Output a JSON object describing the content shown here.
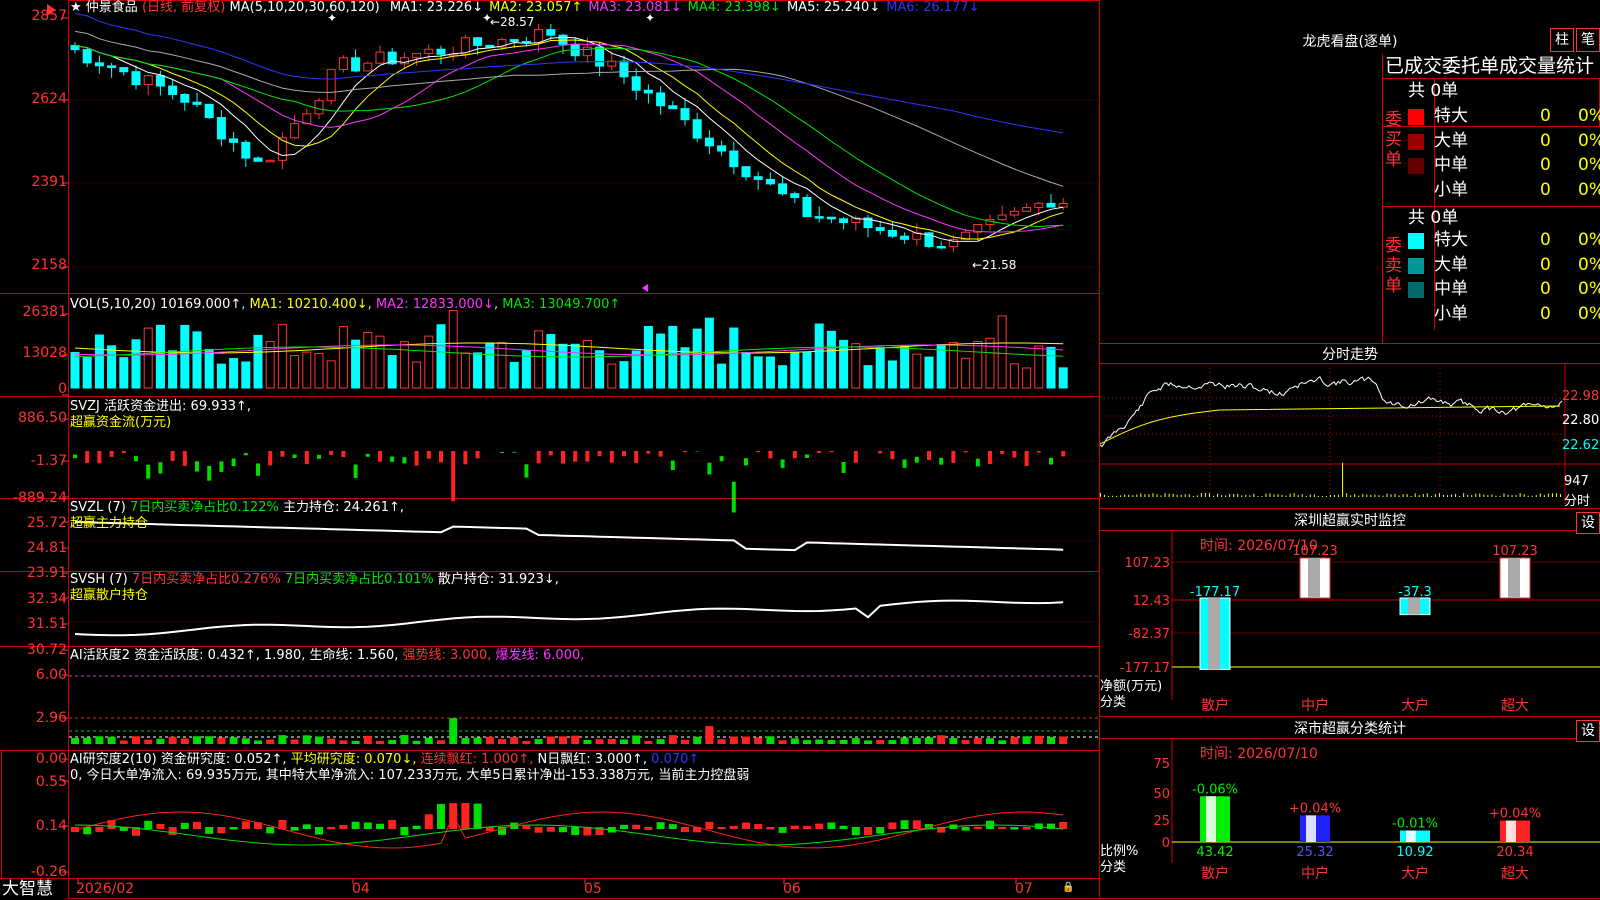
{
  "stock": {
    "name": "仲景食品",
    "mode": "(日线, 前复权)",
    "ma_params": "MA(5,10,20,30,60,120)",
    "ma": [
      {
        "label": "MA1:",
        "value": "23.226↓",
        "color": "#ffffff"
      },
      {
        "label": "MA2:",
        "value": "23.057↑",
        "color": "#ffff00"
      },
      {
        "label": "MA3:",
        "value": "23.081↓",
        "color": "#ff33ff"
      },
      {
        "label": "MA4:",
        "value": "23.398↓",
        "color": "#00e600"
      },
      {
        "label": "MA5:",
        "value": "25.240↓",
        "color": "#ffffff"
      },
      {
        "label": "MA6:",
        "value": "26.177↓",
        "color": "#3333ff"
      }
    ],
    "high_label": "28.57",
    "low_label": "21.58"
  },
  "price_axis": [
    "2857",
    "2624",
    "2391",
    "2158"
  ],
  "vol_panel": {
    "title": "VOL(5,10,20)",
    "value": "10169.000↑",
    "ma1": "MA1: 10210.400↓",
    "ma2": "MA2: 12833.000↓",
    "ma3": "MA3: 13049.700↑",
    "axis": [
      "26381",
      "13028",
      "0"
    ]
  },
  "svzj_panel": {
    "title": "SVZJ",
    "line1": "活跃资金进出: 69.933↑,",
    "line2": "超赢资金流(万元)",
    "axis": [
      "886.50",
      "-1.37",
      "-889.24"
    ]
  },
  "svzl_panel": {
    "title": "SVZL (7)",
    "seg1": "7日内买卖净占比0.122%",
    "seg2": "主力持仓: 24.261↑,",
    "line2": "超赢主力持仓",
    "axis": [
      "25.72",
      "24.81",
      "23.91"
    ]
  },
  "svsh_panel": {
    "title": "SVSH (7)",
    "seg1": "7日内买卖净占比0.276%",
    "seg2": "7日内买卖净占比0.101%",
    "seg3": "散户持仓: 31.923↓,",
    "line2": "超赢散户持仓",
    "axis": [
      "32.34",
      "31.51",
      "30.72"
    ]
  },
  "ai_active_panel": {
    "seg1": "AI活跃度2 资金活跃度: 0.432↑, 1.980, 生命线: 1.560,",
    "seg2": "强势线: 3.000,",
    "seg3": "爆发线: 6.000,",
    "axis": [
      "6.00",
      "2.96",
      "0.00"
    ]
  },
  "ai_research_panel": {
    "seg1": "AI研究度2(10) 资金研究度: 0.052↑,",
    "seg2": "平均研究度: 0.070↓,",
    "seg3": "连续飘红: 1.000↑,",
    "seg4": "N日飘红: 3.000↑,",
    "seg5": "0.070↑",
    "line2": "0, 今日大单净流入: 69.935万元, 其中特大单净流入: 107.233万元, 大单5日累计净出-153.338万元, 当前主力控盘弱",
    "axis": [
      "0.55",
      "0.14",
      "-0.26"
    ]
  },
  "x_axis": [
    "2026/02",
    "04",
    "05",
    "06",
    "07"
  ],
  "footer_brand": "大智慧",
  "lhb": {
    "title": "龙虎看盘(逐单)",
    "btn1": "柱",
    "btn2": "笔",
    "stats_title": "已成交委托单成交量统计",
    "buy_label": "委买单",
    "sell_label": "委卖单",
    "buy_total": "共 0单",
    "sell_total": "共 0单",
    "buy_rows": [
      {
        "name": "特大",
        "value": "0",
        "pct": "0%",
        "color": "#ff0000"
      },
      {
        "name": "大单",
        "value": "0",
        "pct": "0%",
        "color": "#990000"
      },
      {
        "name": "中单",
        "value": "0",
        "pct": "0%",
        "color": "#660000"
      },
      {
        "name": "小单",
        "value": "0",
        "pct": "0%",
        "color": "#000000"
      }
    ],
    "sell_rows": [
      {
        "name": "特大",
        "value": "0",
        "pct": "0%",
        "color": "#00ffff"
      },
      {
        "name": "大单",
        "value": "0",
        "pct": "0%",
        "color": "#009999"
      },
      {
        "name": "中单",
        "value": "0",
        "pct": "0%",
        "color": "#006b6b"
      },
      {
        "name": "小单",
        "value": "0",
        "pct": "0%",
        "color": "#000000"
      }
    ]
  },
  "intraday": {
    "title": "分时走势",
    "axis": [
      "22.98",
      "22.80",
      "22.62"
    ],
    "vol_label": "947",
    "vol_unit": "分时"
  },
  "sz_monitor": {
    "title": "深圳超赢实时监控",
    "btn": "设",
    "time": "时间: 2026/07/10",
    "axis": [
      "107.23",
      "12.43",
      "-82.37",
      "-177.17"
    ],
    "ylabel1": "净额(万元)",
    "ylabel2": "分类",
    "categories": [
      "散户",
      "中户",
      "大户",
      "超大"
    ],
    "values": [
      "-177.17",
      "107.23",
      "-37.3",
      "107.23"
    ]
  },
  "sz_stats": {
    "title": "深市超赢分类统计",
    "btn": "设",
    "time": "时间: 2026/07/10",
    "axis": [
      "75",
      "50",
      "25",
      "0"
    ],
    "ylabel1": "比例%",
    "ylabel2": "分类",
    "categories": [
      "散户",
      "中户",
      "大户",
      "超大"
    ],
    "bar_values": [
      43.42,
      25.32,
      10.92,
      20.34
    ],
    "bar_labels": [
      "43.42",
      "25.32",
      "10.92",
      "20.34"
    ],
    "pct_changes": [
      "-0.06%",
      "+0.04%",
      "-0.01%",
      "+0.04%"
    ]
  }
}
